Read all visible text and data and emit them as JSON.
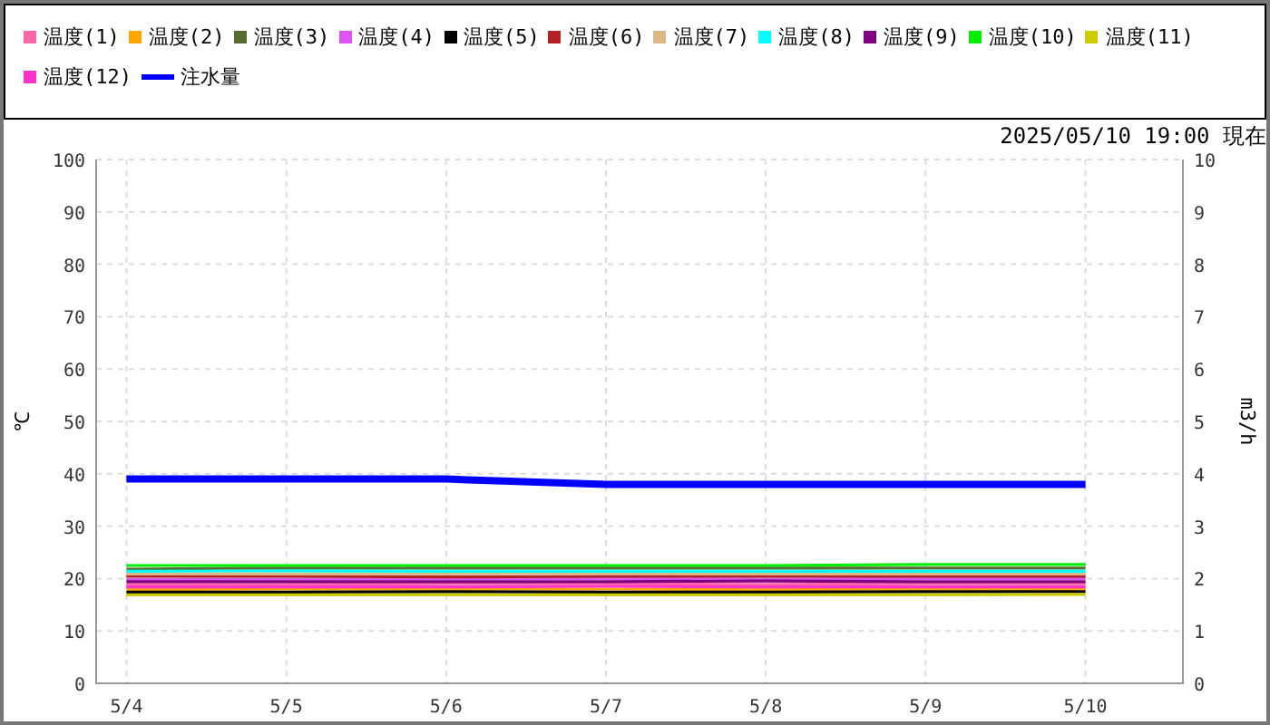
{
  "timestamp": "2025/05/10 19:00 現在",
  "chart_data": {
    "type": "line",
    "grid": true,
    "ylabel": "℃",
    "y2label": "m3/h",
    "categories": [
      "5/4",
      "5/5",
      "5/6",
      "5/7",
      "5/8",
      "5/9",
      "5/10"
    ],
    "ylim": [
      0,
      100
    ],
    "yticks": [
      0,
      10,
      20,
      30,
      40,
      50,
      60,
      70,
      80,
      90,
      100
    ],
    "y2lim": [
      0,
      10
    ],
    "y2ticks": [
      0,
      1,
      2,
      3,
      4,
      5,
      6,
      7,
      8,
      9,
      10
    ],
    "series": [
      {
        "name": "温度(1)",
        "color": "#ff66aa",
        "values": [
          18.9,
          18.9,
          19.0,
          19.0,
          18.9,
          19.0,
          19.0
        ]
      },
      {
        "name": "温度(2)",
        "color": "#ffa500",
        "values": [
          17.9,
          18.0,
          18.0,
          18.0,
          17.9,
          18.0,
          18.0
        ]
      },
      {
        "name": "温度(3)",
        "color": "#556b2f",
        "values": [
          21.8,
          22.0,
          22.0,
          22.0,
          22.0,
          22.0,
          22.0
        ]
      },
      {
        "name": "温度(4)",
        "color": "#dd55ee",
        "values": [
          19.8,
          19.9,
          19.9,
          20.0,
          19.9,
          20.0,
          20.0
        ]
      },
      {
        "name": "温度(5)",
        "color": "#000000",
        "values": [
          17.4,
          17.4,
          17.5,
          17.4,
          17.4,
          17.5,
          17.5
        ]
      },
      {
        "name": "温度(6)",
        "color": "#b22222",
        "values": [
          20.4,
          20.4,
          20.3,
          20.4,
          20.4,
          20.4,
          20.4
        ]
      },
      {
        "name": "温度(7)",
        "color": "#deb887",
        "values": [
          20.9,
          20.9,
          20.9,
          21.0,
          20.9,
          20.9,
          20.9
        ]
      },
      {
        "name": "温度(8)",
        "color": "#00ffff",
        "values": [
          21.4,
          21.5,
          21.4,
          21.4,
          21.4,
          21.4,
          21.4
        ]
      },
      {
        "name": "温度(9)",
        "color": "#800080",
        "values": [
          19.4,
          19.4,
          19.4,
          19.4,
          19.5,
          19.4,
          19.4
        ]
      },
      {
        "name": "温度(10)",
        "color": "#00ee00",
        "values": [
          22.5,
          22.5,
          22.5,
          22.5,
          22.5,
          22.7,
          22.7
        ]
      },
      {
        "name": "温度(11)",
        "color": "#cccc00",
        "values": [
          16.9,
          16.9,
          16.9,
          16.9,
          16.9,
          16.9,
          17.0
        ]
      },
      {
        "name": "温度(12)",
        "color": "#ff33cc",
        "values": [
          18.4,
          18.4,
          18.4,
          18.5,
          18.4,
          18.4,
          18.4
        ]
      },
      {
        "name": "注水量",
        "color": "#0000ff",
        "axis": "y2",
        "values": [
          3.9,
          3.9,
          3.9,
          3.8,
          3.8,
          3.8,
          3.8
        ]
      }
    ]
  }
}
